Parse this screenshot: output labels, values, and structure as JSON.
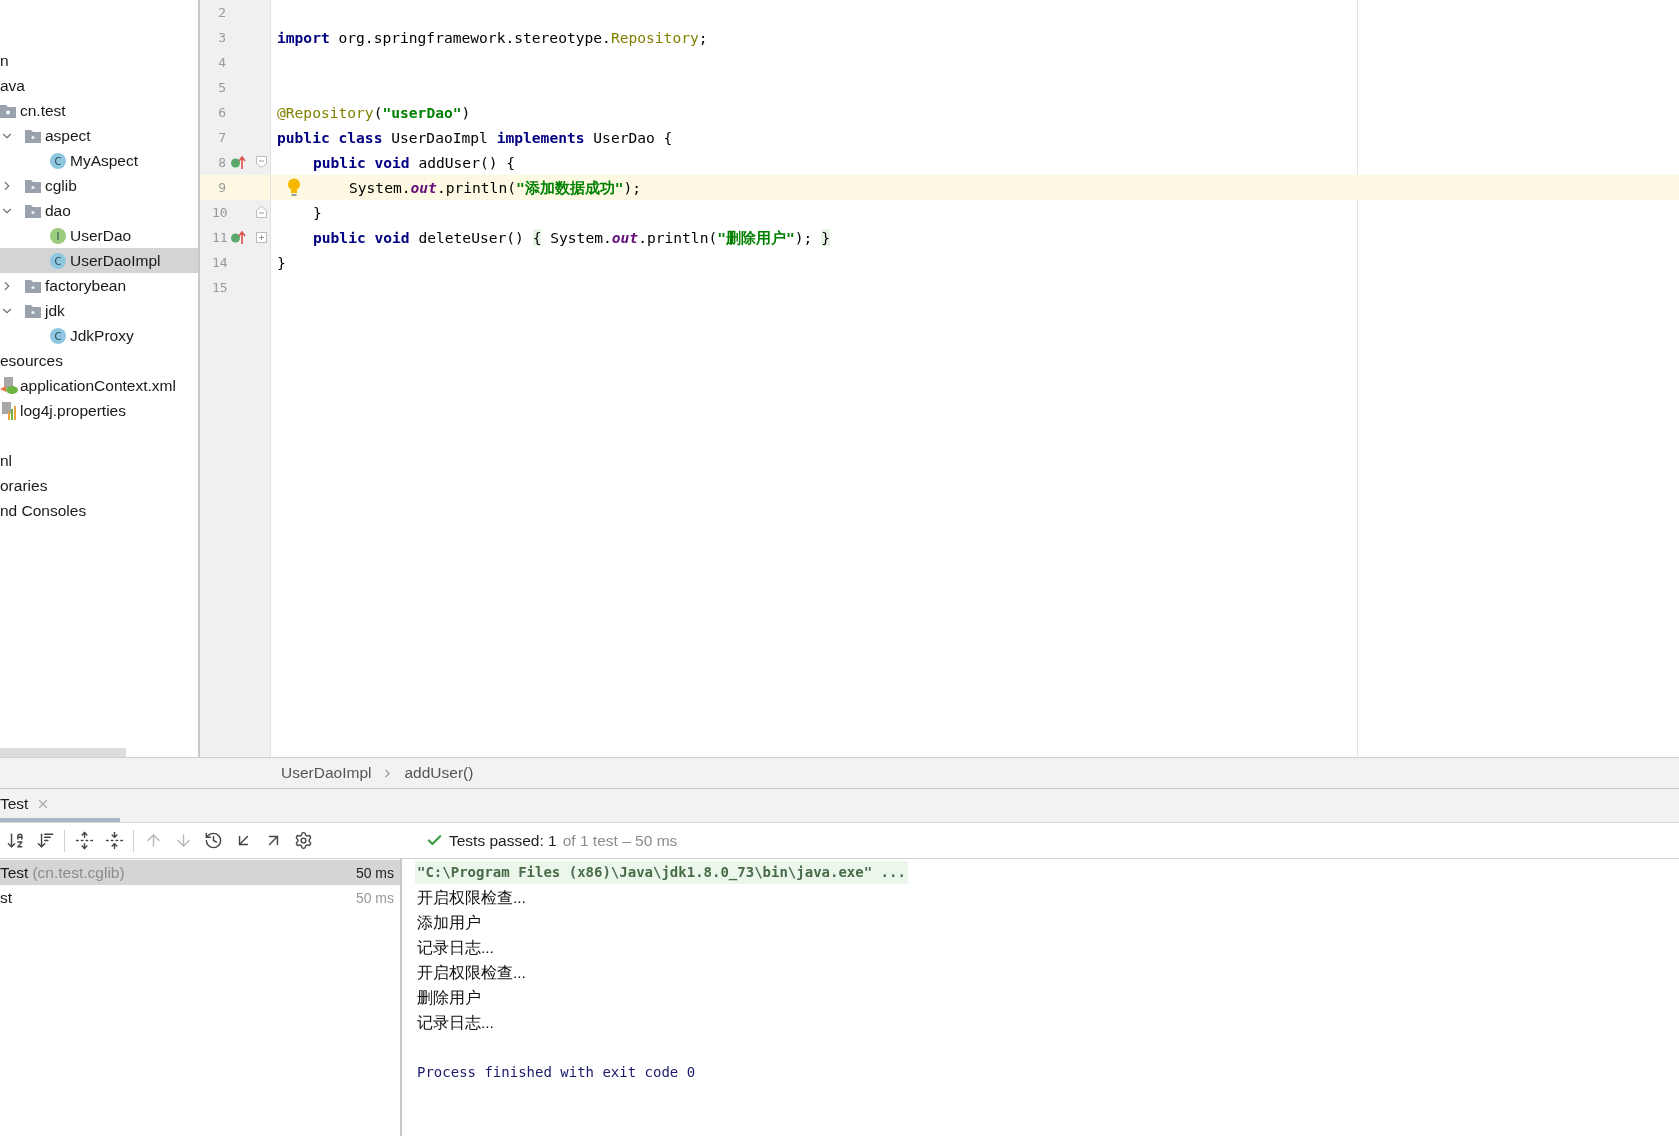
{
  "project_tree": {
    "items": [
      {
        "label": "n",
        "selected": false,
        "children": [
          {
            "label": "ava",
            "selected": false,
            "children": [
              {
                "label": "cn.test",
                "kind": "package",
                "selected": false,
                "children": [
                  {
                    "label": "aspect",
                    "kind": "folder",
                    "expanded": true,
                    "selected": false,
                    "children": [
                      {
                        "label": "MyAspect",
                        "kind": "class",
                        "badge": "C",
                        "selected": false
                      }
                    ]
                  },
                  {
                    "label": "cglib",
                    "kind": "folder",
                    "expanded": false,
                    "selected": false
                  },
                  {
                    "label": "dao",
                    "kind": "folder",
                    "expanded": true,
                    "selected": false,
                    "children": [
                      {
                        "label": "UserDao",
                        "kind": "interface",
                        "badge": "I",
                        "selected": false
                      },
                      {
                        "label": "UserDaoImpl",
                        "kind": "class",
                        "badge": "C",
                        "selected": true
                      }
                    ]
                  },
                  {
                    "label": "factorybean",
                    "kind": "folder",
                    "expanded": false,
                    "selected": false
                  },
                  {
                    "label": "jdk",
                    "kind": "folder",
                    "expanded": true,
                    "selected": false,
                    "children": [
                      {
                        "label": "JdkProxy",
                        "kind": "class",
                        "badge": "C",
                        "selected": false
                      }
                    ]
                  }
                ]
              }
            ]
          },
          {
            "label": "esources",
            "selected": false,
            "children": [
              {
                "label": "applicationContext.xml",
                "kind": "xml",
                "selected": false
              },
              {
                "label": "log4j.properties",
                "kind": "properties",
                "selected": false
              }
            ]
          }
        ]
      },
      {
        "label": "nl",
        "selected": false
      },
      {
        "label": "oraries",
        "selected": false
      },
      {
        "label": "nd Consoles",
        "selected": false
      }
    ]
  },
  "editor": {
    "lines": [
      {
        "number": "2",
        "kind": "top",
        "current": false,
        "bulb": false,
        "implements_mark": false,
        "fold_start": false,
        "fold_end": false,
        "folded": false
      },
      {
        "number": "3",
        "kind": "top",
        "current": false,
        "bulb": false,
        "implements_mark": false,
        "fold_start": false,
        "fold_end": false,
        "folded": false,
        "tokens": [
          {
            "kind": "keyword",
            "text": "import"
          },
          {
            "kind": "plain",
            "text": " org.springframework.stereotype."
          },
          {
            "kind": "annotation",
            "text": "Repository"
          },
          {
            "kind": "plain",
            "text": ";"
          }
        ]
      },
      {
        "number": "4",
        "kind": "top",
        "current": false,
        "bulb": false,
        "implements_mark": false,
        "fold_start": false,
        "fold_end": false,
        "folded": false
      },
      {
        "number": "5",
        "kind": "top",
        "current": false,
        "bulb": false,
        "implements_mark": false,
        "fold_start": false,
        "fold_end": false,
        "folded": false
      },
      {
        "number": "6",
        "kind": "top",
        "current": false,
        "bulb": false,
        "implements_mark": false,
        "fold_start": false,
        "fold_end": false,
        "folded": false,
        "tokens": [
          {
            "kind": "annotation",
            "text": "@Repository"
          },
          {
            "kind": "plain",
            "text": "("
          },
          {
            "kind": "string",
            "text": "\"userDao\""
          },
          {
            "kind": "plain",
            "text": ")"
          }
        ]
      },
      {
        "number": "7",
        "kind": "top",
        "current": false,
        "bulb": false,
        "implements_mark": false,
        "fold_start": false,
        "fold_end": false,
        "folded": false,
        "tokens": [
          {
            "kind": "keyword",
            "text": "public class"
          },
          {
            "kind": "plain",
            "text": " UserDaoImpl "
          },
          {
            "kind": "keyword",
            "text": "implements"
          },
          {
            "kind": "plain",
            "text": " UserDao {"
          }
        ]
      },
      {
        "number": "8",
        "kind": "member",
        "current": false,
        "bulb": false,
        "implements_mark": true,
        "fold_start": true,
        "fold_end": false,
        "folded": false,
        "tokens": [
          {
            "kind": "keyword",
            "text": "public void"
          },
          {
            "kind": "plain",
            "text": " addUser() {"
          }
        ]
      },
      {
        "number": "9",
        "kind": "statement",
        "current": true,
        "bulb": true,
        "implements_mark": false,
        "fold_start": false,
        "fold_end": false,
        "folded": false,
        "tokens": [
          {
            "kind": "plain",
            "text": "System."
          },
          {
            "kind": "static",
            "text": "out"
          },
          {
            "kind": "plain",
            "text": ".println("
          },
          {
            "kind": "string",
            "text": "\"添加数据成功\""
          },
          {
            "kind": "plain",
            "text": ");"
          }
        ]
      },
      {
        "number": "10",
        "kind": "member",
        "current": false,
        "bulb": false,
        "implements_mark": false,
        "fold_start": false,
        "fold_end": true,
        "folded": false,
        "tokens": [
          {
            "kind": "plain",
            "text": "}"
          }
        ]
      },
      {
        "number": "11",
        "kind": "member",
        "current": false,
        "bulb": false,
        "implements_mark": true,
        "fold_start": false,
        "fold_end": false,
        "folded": true,
        "tokens": [
          {
            "kind": "keyword",
            "text": "public void"
          },
          {
            "kind": "plain",
            "text": " deleteUser() "
          },
          {
            "kind": "folded",
            "text": "{"
          },
          {
            "kind": "plain",
            "text": " System."
          },
          {
            "kind": "static",
            "text": "out"
          },
          {
            "kind": "plain",
            "text": ".println("
          },
          {
            "kind": "string",
            "text": "\"删除用户\""
          },
          {
            "kind": "plain",
            "text": "); "
          },
          {
            "kind": "folded",
            "text": "}"
          }
        ]
      },
      {
        "number": "14",
        "kind": "top",
        "current": false,
        "bulb": false,
        "implements_mark": false,
        "fold_start": false,
        "fold_end": false,
        "folded": false,
        "tokens": [
          {
            "kind": "plain",
            "text": "}"
          }
        ]
      },
      {
        "number": "15",
        "kind": "top",
        "current": false,
        "bulb": false,
        "implements_mark": false,
        "fold_start": false,
        "fold_end": false,
        "folded": false
      }
    ]
  },
  "breadcrumbs": [
    "UserDaoImpl",
    "addUser()"
  ],
  "run_panel": {
    "tabs": [
      {
        "label": "Test",
        "selected": true
      }
    ],
    "toolbar": {
      "groups": [
        [
          {
            "kind": "sort-alpha",
            "disabled": false
          },
          {
            "kind": "sort-duration",
            "disabled": false
          }
        ],
        [
          {
            "kind": "expand-all",
            "disabled": false
          },
          {
            "kind": "collapse-all",
            "disabled": false
          }
        ],
        [
          {
            "kind": "previous",
            "disabled": true
          },
          {
            "kind": "next",
            "disabled": true
          },
          {
            "kind": "history",
            "disabled": false
          },
          {
            "kind": "import",
            "disabled": false
          },
          {
            "kind": "export",
            "disabled": false
          },
          {
            "kind": "settings",
            "disabled": false
          }
        ]
      ]
    },
    "status": {
      "passed": "Tests passed: 1",
      "detail": "of 1 test – 50 ms"
    },
    "tests": [
      {
        "kind": "suite",
        "name": "Test",
        "package": "(cn.test.cglib)",
        "duration": "50 ms",
        "selected": true
      },
      {
        "kind": "case",
        "name": "st",
        "duration": "50 ms",
        "selected": false
      }
    ],
    "console": [
      {
        "kind": "command",
        "text": "\"C:\\Program Files (x86)\\Java\\jdk1.8.0_73\\bin\\java.exe\" ..."
      },
      {
        "kind": "output",
        "text": "开启权限检查..."
      },
      {
        "kind": "output",
        "text": "添加用户"
      },
      {
        "kind": "output",
        "text": "记录日志..."
      },
      {
        "kind": "output",
        "text": "开启权限检查..."
      },
      {
        "kind": "output",
        "text": "删除用户"
      },
      {
        "kind": "output",
        "text": "记录日志..."
      },
      {
        "kind": "exit",
        "text": "Process finished with exit code 0"
      }
    ]
  }
}
